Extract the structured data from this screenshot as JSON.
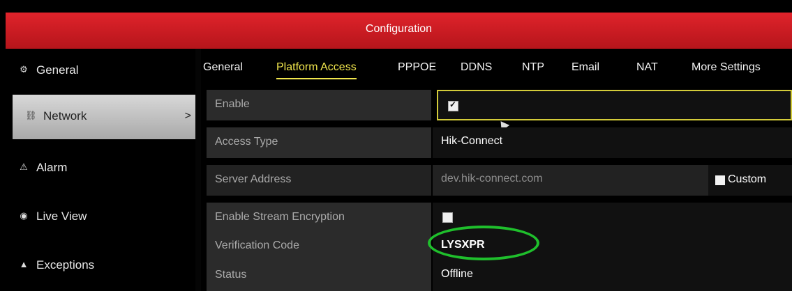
{
  "header": {
    "title": "Configuration"
  },
  "sidebar": {
    "items": [
      {
        "label": "General",
        "icon": "gear-icon"
      },
      {
        "label": "Network",
        "icon": "network-icon",
        "active": true,
        "chevron": ">"
      },
      {
        "label": "Alarm",
        "icon": "alarm-icon"
      },
      {
        "label": "Live View",
        "icon": "eye-icon"
      },
      {
        "label": "Exceptions",
        "icon": "warning-icon"
      }
    ]
  },
  "tabs": [
    {
      "label": "General"
    },
    {
      "label": "Platform Access",
      "active": true
    },
    {
      "label": "PPPOE"
    },
    {
      "label": "DDNS"
    },
    {
      "label": "NTP"
    },
    {
      "label": "Email"
    },
    {
      "label": "NAT"
    },
    {
      "label": "More Settings"
    }
  ],
  "form": {
    "enable": {
      "label": "Enable",
      "checked": true
    },
    "access_type": {
      "label": "Access Type",
      "value": "Hik-Connect"
    },
    "server_address": {
      "label": "Server Address",
      "value": "dev.hik-connect.com",
      "custom_label": "Custom"
    },
    "stream_encryption": {
      "label": "Enable Stream Encryption",
      "checked": false
    },
    "verification_code": {
      "label": "Verification Code",
      "value": "LYSXPR"
    },
    "status": {
      "label": "Status",
      "value": "Offline"
    }
  },
  "colors": {
    "header_red": "#d51f26",
    "tab_active": "#f1e64d",
    "highlight_green": "#1fbf2c"
  }
}
